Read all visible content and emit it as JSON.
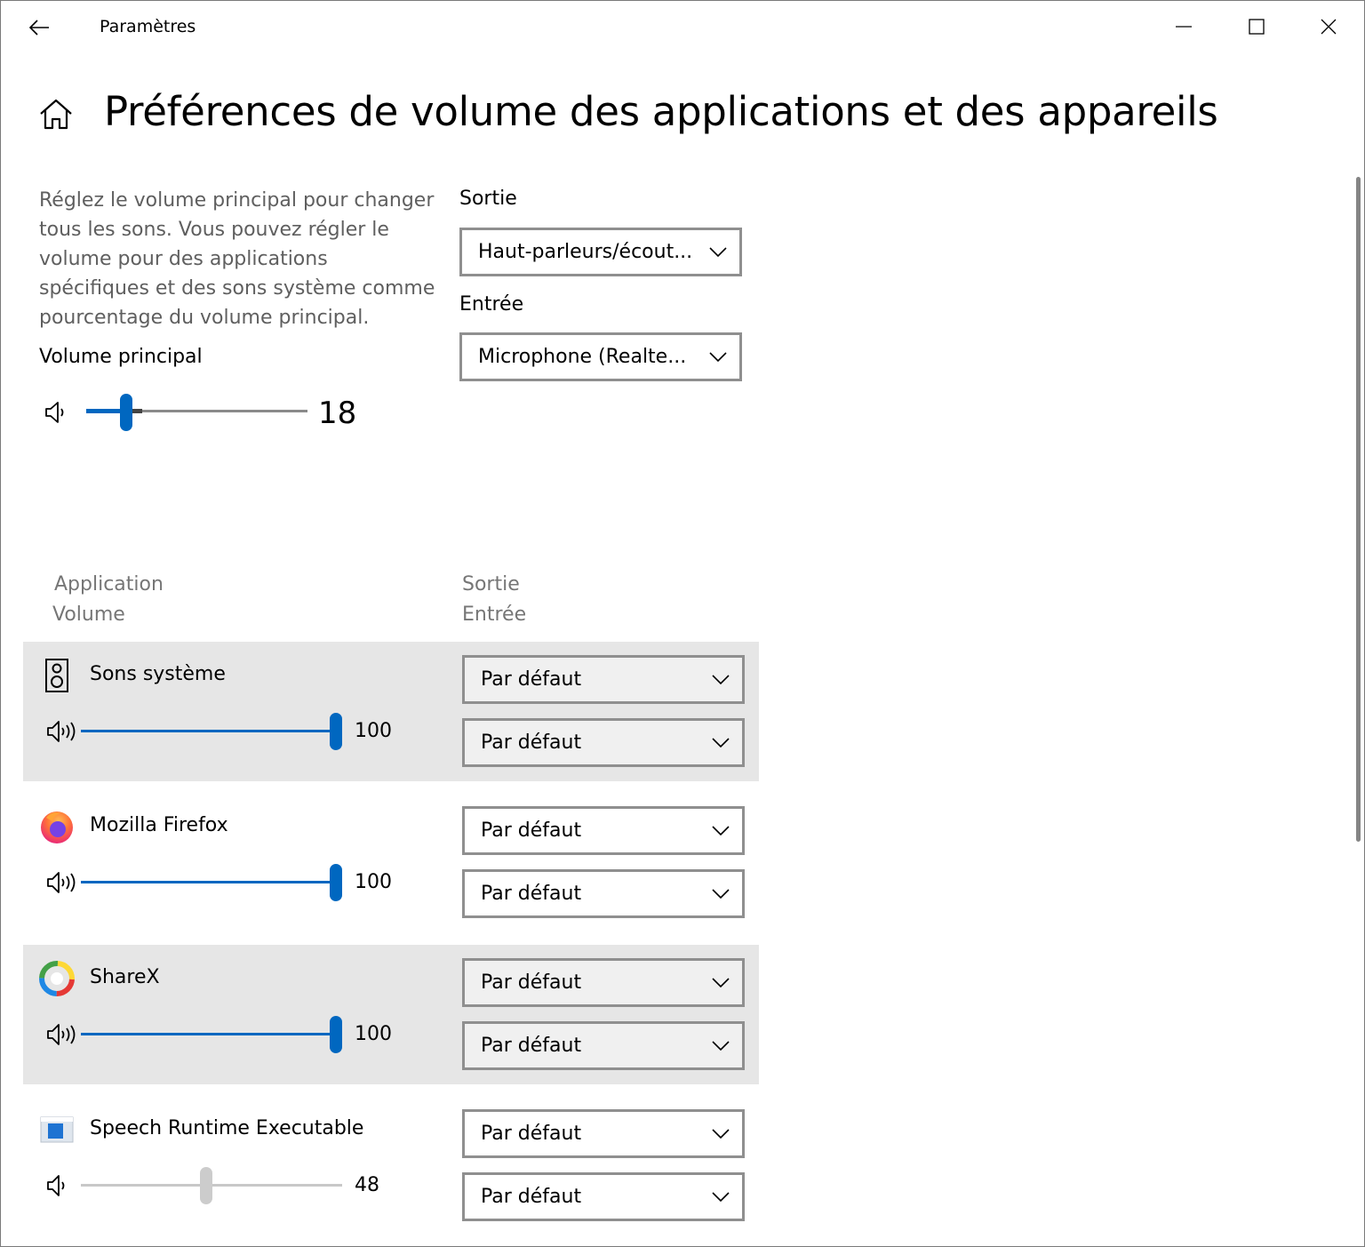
{
  "window": {
    "title": "Paramètres",
    "controls": {
      "minimize": "minimize",
      "maximize": "maximize",
      "close": "close"
    }
  },
  "header": {
    "title": "Préférences de volume des applications et des appareils"
  },
  "intro": {
    "description": "Réglez le volume principal pour changer tous les sons. Vous pouvez régler le volume pour des applications spécifiques et des sons système comme pourcentage du volume principal.",
    "master_label": "Volume principal",
    "master_value": "18",
    "master_level": 18
  },
  "devices": {
    "output_label": "Sortie",
    "output_value": "Haut-parleurs/écout...",
    "input_label": "Entrée",
    "input_value": "Microphone (Realte..."
  },
  "columns": {
    "application": "Application",
    "volume": "Volume",
    "output": "Sortie",
    "input": "Entrée"
  },
  "apps": [
    {
      "name": "Sons système",
      "icon": "speaker-box-icon",
      "volume": "100",
      "level": 100,
      "output": "Par défaut",
      "input": "Par défaut"
    },
    {
      "name": "Mozilla Firefox",
      "icon": "firefox-icon",
      "volume": "100",
      "level": 100,
      "output": "Par défaut",
      "input": "Par défaut"
    },
    {
      "name": "ShareX",
      "icon": "sharex-icon",
      "volume": "100",
      "level": 100,
      "output": "Par défaut",
      "input": "Par défaut"
    },
    {
      "name": "Speech Runtime Executable",
      "icon": "window-app-icon",
      "volume": "48",
      "level": 48,
      "output": "Par défaut",
      "input": "Par défaut"
    }
  ],
  "colors": {
    "accent": "#0067c0",
    "row_shade": "#e6e6e6",
    "muted_text": "#767676"
  }
}
